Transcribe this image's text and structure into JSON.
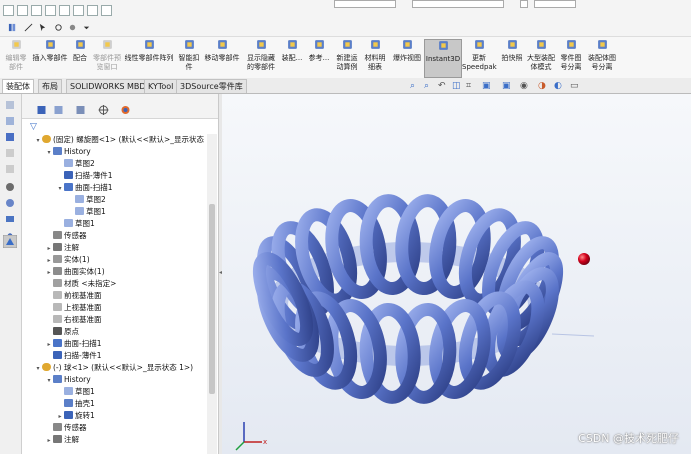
{
  "ribbon": {
    "buttons": [
      {
        "label": "编辑零\n部件",
        "disabled": true,
        "icon": "edit-part-icon"
      },
      {
        "label": "插入零部件",
        "icon": "insert-component-icon"
      },
      {
        "label": "配合",
        "icon": "mate-icon"
      },
      {
        "label": "零部件预\n览窗口",
        "disabled": true,
        "icon": "component-preview-icon"
      },
      {
        "label": "线性零部件阵列",
        "icon": "linear-pattern-icon"
      },
      {
        "label": "智能扣\n件",
        "icon": "smart-fastener-icon"
      },
      {
        "label": "移动零部件",
        "icon": "move-component-icon"
      },
      {
        "label": "显示隐藏\n的零部件",
        "icon": "show-hidden-icon"
      },
      {
        "label": "装配...",
        "icon": "assembly-feature-icon"
      },
      {
        "label": "参考...",
        "icon": "reference-geometry-icon"
      },
      {
        "label": "新建运\n动算例",
        "icon": "new-motion-study-icon"
      },
      {
        "label": "材料明\n细表",
        "icon": "bom-icon"
      },
      {
        "label": "爆炸视图",
        "icon": "exploded-view-icon"
      },
      {
        "label": "Instant3D",
        "active": true,
        "icon": "instant3d-icon"
      },
      {
        "label": "更新\nSpeedpak",
        "icon": "speedpak-icon"
      },
      {
        "label": "拍快照",
        "icon": "snapshot-icon"
      },
      {
        "label": "大型装配\n体模式",
        "icon": "large-assembly-icon"
      },
      {
        "label": "零件图\n号分离",
        "icon": "part-number-split-icon"
      },
      {
        "label": "装配体图\n号分离",
        "icon": "assembly-number-split-icon"
      }
    ]
  },
  "tabs": [
    {
      "label": "装配体",
      "active": true
    },
    {
      "label": "布局"
    },
    {
      "label": "SOLIDWORKS MBD"
    },
    {
      "label": "KYTool"
    },
    {
      "label": "3DSource零件库"
    }
  ],
  "tree": [
    {
      "indent": 0,
      "arrow": "▾",
      "icon": "part-icon",
      "label": "(固定) 螺旋圈<1> (默认<<默认>_显示状态 1>)"
    },
    {
      "indent": 1,
      "arrow": "▾",
      "icon": "history-icon",
      "label": "History"
    },
    {
      "indent": 2,
      "arrow": "",
      "icon": "sketch-icon",
      "label": "草图2"
    },
    {
      "indent": 2,
      "arrow": "",
      "icon": "sweep-icon",
      "label": "扫描-薄件1"
    },
    {
      "indent": 2,
      "arrow": "▾",
      "icon": "surface-sweep-icon",
      "label": "曲面-扫描1"
    },
    {
      "indent": 3,
      "arrow": "",
      "icon": "sketch-icon",
      "label": "草图2"
    },
    {
      "indent": 3,
      "arrow": "",
      "icon": "sketch-icon",
      "label": "草图1"
    },
    {
      "indent": 2,
      "arrow": "",
      "icon": "sketch-icon",
      "label": "草图1"
    },
    {
      "indent": 1,
      "arrow": "",
      "icon": "sensor-icon",
      "label": "传感器"
    },
    {
      "indent": 1,
      "arrow": "▸",
      "icon": "annotation-icon",
      "label": "注解"
    },
    {
      "indent": 1,
      "arrow": "▸",
      "icon": "solid-body-icon",
      "label": "实体(1)"
    },
    {
      "indent": 1,
      "arrow": "▸",
      "icon": "surface-body-icon",
      "label": "曲面实体(1)"
    },
    {
      "indent": 1,
      "arrow": "",
      "icon": "material-icon",
      "label": "材质 <未指定>"
    },
    {
      "indent": 1,
      "arrow": "",
      "icon": "plane-icon",
      "label": "前视基准面"
    },
    {
      "indent": 1,
      "arrow": "",
      "icon": "plane-icon",
      "label": "上视基准面"
    },
    {
      "indent": 1,
      "arrow": "",
      "icon": "plane-icon",
      "label": "右视基准面"
    },
    {
      "indent": 1,
      "arrow": "",
      "icon": "origin-icon",
      "label": "原点"
    },
    {
      "indent": 1,
      "arrow": "▸",
      "icon": "surface-sweep-icon",
      "label": "曲面-扫描1"
    },
    {
      "indent": 1,
      "arrow": "",
      "icon": "sweep-icon",
      "label": "扫描-薄件1"
    },
    {
      "indent": 0,
      "arrow": "▾",
      "icon": "part-icon",
      "label": "(-) 球<1> (默认<<默认>_显示状态 1>)"
    },
    {
      "indent": 1,
      "arrow": "▾",
      "icon": "history-icon",
      "label": "History"
    },
    {
      "indent": 2,
      "arrow": "",
      "icon": "sketch-icon",
      "label": "草图1"
    },
    {
      "indent": 2,
      "arrow": "",
      "icon": "shell-icon",
      "label": "抽壳1"
    },
    {
      "indent": 2,
      "arrow": "▸",
      "icon": "revolve-icon",
      "label": "旋转1"
    },
    {
      "indent": 1,
      "arrow": "",
      "icon": "sensor-icon",
      "label": "传感器"
    },
    {
      "indent": 1,
      "arrow": "▸",
      "icon": "annotation-icon",
      "label": "注解"
    }
  ],
  "watermark": "CSDN @技术死肥仔",
  "colors": {
    "coil": "#5a74c9",
    "ball": "#d3001b",
    "accent": "#3a6ec8"
  }
}
